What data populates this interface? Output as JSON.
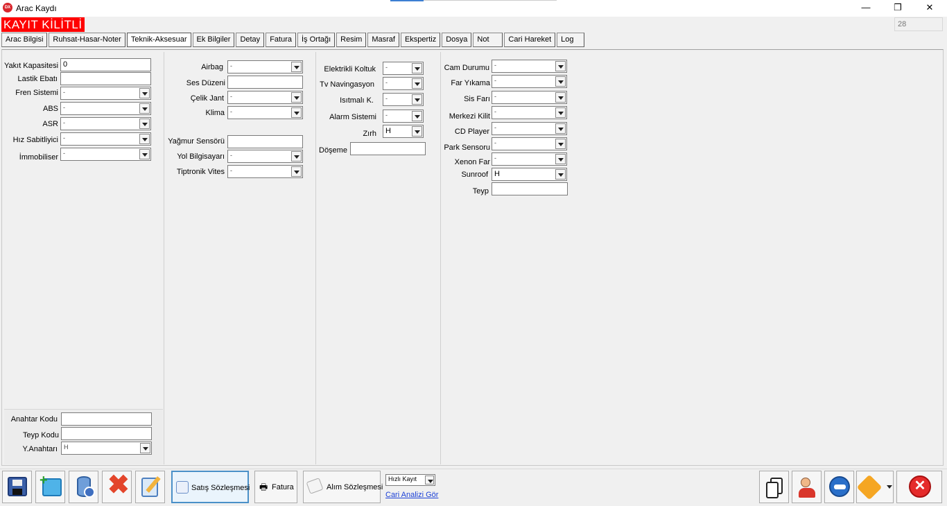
{
  "window": {
    "title": "Arac Kaydı",
    "icon_text": "DX",
    "minimize": "—",
    "restore": "❐",
    "close": "✕"
  },
  "status": {
    "lock_text": "KAYIT KİLİTLİ",
    "counter": "28"
  },
  "tabs": [
    "Arac Bilgisi",
    "Ruhsat-Hasar-Noter",
    "Teknik-Aksesuar",
    "Ek Bilgiler",
    "Detay",
    "Fatura",
    "İş Ortağı",
    "Resim",
    "Masraf",
    "Ekspertiz",
    "Dosya",
    "Not",
    "Cari Hareket",
    "Log"
  ],
  "col1": {
    "yakit_label": "Yakıt Kapasitesi",
    "yakit_value": "0",
    "lastik_label": "Lastik Ebatı",
    "lastik_value": "",
    "fren_label": "Fren Sistemi",
    "fren_value": "-",
    "abs_label": "ABS",
    "abs_value": "-",
    "asr_label": "ASR",
    "asr_value": "-",
    "hiz_label": "Hız Sabitliyici",
    "hiz_value": "-",
    "immo_label": "İmmobiliser",
    "immo_value": "-",
    "anahtar_label": "Anahtar Kodu",
    "anahtar_value": "",
    "teypkod_label": "Teyp Kodu",
    "teypkod_value": "",
    "yanahtar_label": "Y.Anahtarı",
    "yanahtar_value": "H"
  },
  "col2": {
    "airbag_label": "Airbag",
    "airbag_value": "-",
    "ses_label": "Ses Düzeni",
    "ses_value": "",
    "jant_label": "Çelik Jant",
    "jant_value": "-",
    "klima_label": "Klima",
    "klima_value": "-",
    "yagmur_label": "Yağmur Sensörü",
    "yagmur_value": "",
    "yol_label": "Yol Bilgisayarı",
    "yol_value": "-",
    "tiptronik_label": "Tiptronik Vites",
    "tiptronik_value": "-"
  },
  "col3": {
    "koltuk_label": "Elektrikli Koltuk",
    "koltuk_value": "-",
    "tv_label": "Tv Navingasyon",
    "tv_value": "-",
    "isitmali_label": "Isıtmalı K.",
    "isitmali_value": "-",
    "alarm_label": "Alarm Sistemi",
    "alarm_value": "-",
    "zirh_label": "Zırh",
    "zirh_value": "H",
    "doseme_label": "Döşeme",
    "doseme_value": ""
  },
  "col4": {
    "cam_label": "Cam Durumu",
    "cam_value": "-",
    "far_label": "Far Yıkama",
    "far_value": "-",
    "sis_label": "Sis Farı",
    "sis_value": "-",
    "merkezi_label": "Merkezi Kilit",
    "merkezi_value": "-",
    "cd_label": "CD Player",
    "cd_value": "-",
    "park_label": "Park Sensoru",
    "park_value": "-",
    "xenon_label": "Xenon Far",
    "xenon_value": "-",
    "sunroof_label": "Sunroof",
    "sunroof_value": "H",
    "teyp_label": "Teyp",
    "teyp_value": ""
  },
  "toolbar": {
    "satis_label": "Satış Sözleşmesi",
    "fatura_label": "Fatura",
    "alim_label": "Alım Sözleşmesi",
    "hizli_value": "Hızlı Kayıt",
    "cari_link": "Cari Analizi Gör"
  },
  "colors": {
    "lock_bg": "#ff0000",
    "accent": "#4a90c8",
    "close_red": "#e52b2b"
  }
}
